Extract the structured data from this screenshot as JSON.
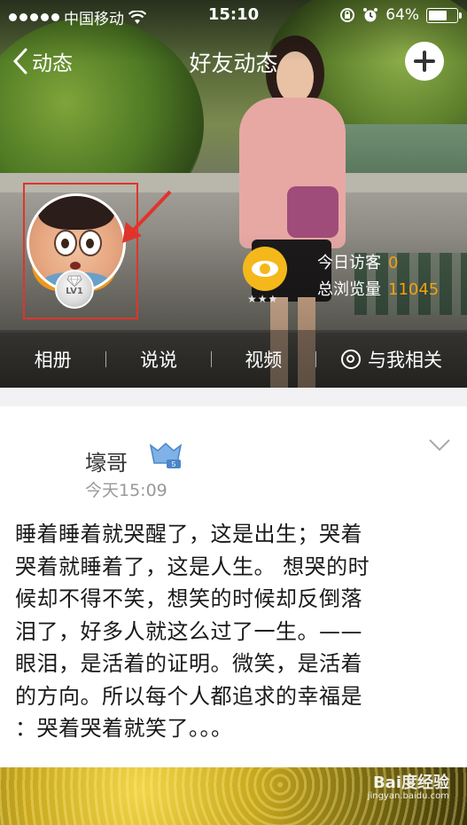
{
  "status_bar": {
    "carrier": "中国移动",
    "time": "15:10",
    "battery": "64%"
  },
  "nav": {
    "back_label": "动态",
    "title": "好友动态"
  },
  "profile": {
    "level_label": "LV1",
    "visitors_label": "今日访客",
    "visitors_value": "0",
    "views_label": "总浏览量",
    "views_value": "11045"
  },
  "tabs": [
    {
      "label": "相册"
    },
    {
      "label": "说说"
    },
    {
      "label": "视频"
    },
    {
      "label": "与我相关"
    }
  ],
  "post": {
    "author": "壕哥",
    "vip_level": "5",
    "time": "今天15:09",
    "lines": [
      "睡着睡着就哭醒了，这是出生；哭着",
      "哭着就睡着了，这是人生。 想哭的时",
      "候却不得不笑，想笑的时候却反倒落",
      "泪了，好多人就这么过了一生。——",
      "眼泪，是活着的证明。微笑，是活着",
      "的方向。所以每个人都追求的幸福是",
      "：哭着哭着就笑了。。。"
    ]
  },
  "watermark": {
    "brand": "Bai度经验",
    "url": "jingyan.baidu.com"
  },
  "colors": {
    "accent_orange": "#f4a012",
    "highlight_red": "#e0342b"
  },
  "icons": [
    "wifi-icon",
    "lock-rotation-icon",
    "alarm-icon",
    "battery-icon",
    "back-chevron-icon",
    "plus-icon",
    "eye-icon",
    "at-icon",
    "diamond-icon",
    "chevron-down-icon",
    "vip-badge-icon",
    "arrow-pointer-icon"
  ]
}
